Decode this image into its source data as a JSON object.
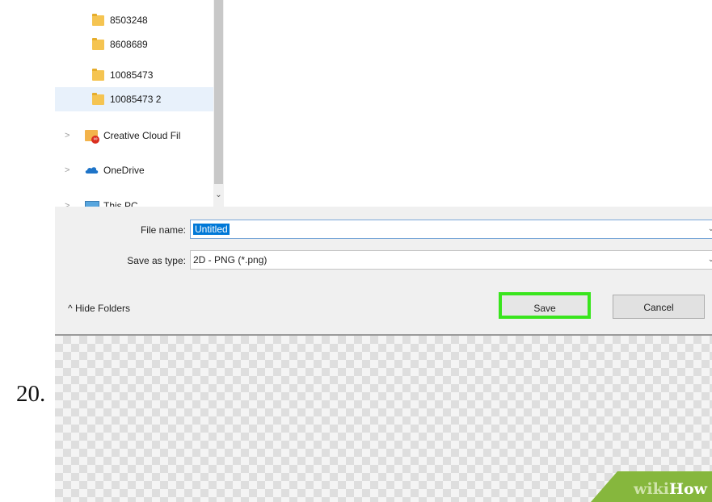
{
  "step_number": "20.",
  "navigation": {
    "items": [
      {
        "label": "8503248",
        "icon": "folder-icon"
      },
      {
        "label": "8608689",
        "icon": "folder-icon"
      },
      {
        "label": "10085473",
        "icon": "folder-icon"
      },
      {
        "label": "10085473 2",
        "icon": "folder-icon",
        "selected": true
      },
      {
        "label": "Creative Cloud Fil",
        "icon": "creative-cloud-icon"
      },
      {
        "label": "OneDrive",
        "icon": "onedrive-icon"
      },
      {
        "label": "This PC",
        "icon": "this-pc-icon"
      }
    ]
  },
  "form": {
    "file_name_label": "File name:",
    "file_name_value": "Untitled",
    "save_type_label": "Save as type:",
    "save_type_value": "2D - PNG (*.png)"
  },
  "footer": {
    "hide_folders_label": "Hide Folders",
    "save_label": "Save",
    "cancel_label": "Cancel"
  },
  "watermark": {
    "part1": "wiki",
    "part2": "How"
  },
  "colors": {
    "highlight_box": "#39e51d",
    "selection": "#0078d7",
    "watermark_band": "#86b73d"
  }
}
